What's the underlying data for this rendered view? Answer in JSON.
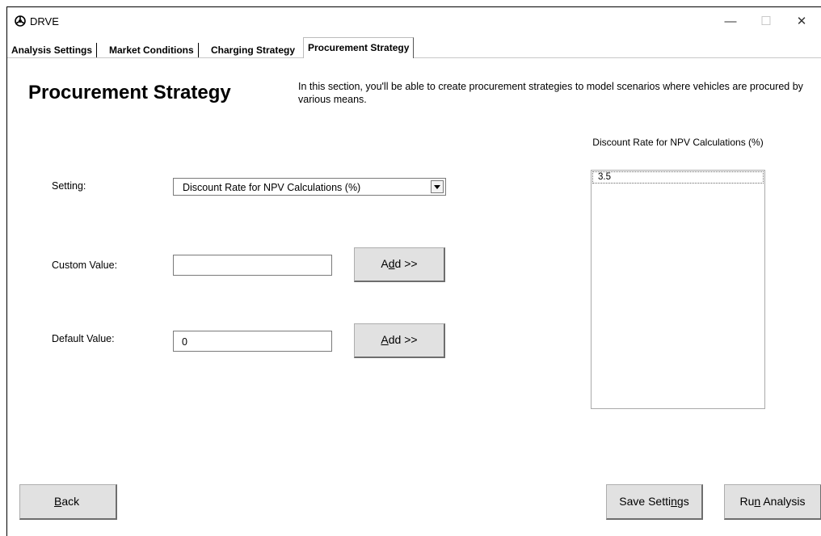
{
  "window": {
    "title": "DRVE",
    "icon": "drve-logo-icon",
    "controls": [
      "minimize",
      "maximize",
      "close"
    ]
  },
  "tabs": [
    {
      "label": "Analysis Settings"
    },
    {
      "label": "Market Conditions"
    },
    {
      "label": "Charging Strategy"
    },
    {
      "label": "Procurement Strategy",
      "active": true
    }
  ],
  "main": {
    "heading": "Procurement Strategy",
    "description": "In this section, you'll be able to create procurement strategies to model scenarios where vehicles are procured by various means."
  },
  "form": {
    "setting_label": "Setting:",
    "setting_value": "Discount Rate for NPV Calculations (%)",
    "custom_label": "Custom Value:",
    "custom_value": "",
    "custom_add_pre": "A",
    "custom_add_key": "d",
    "custom_add_post": "d >>",
    "default_label": "Default Value:",
    "default_value": "0",
    "default_add_key": "A",
    "default_add_post": "dd >>"
  },
  "list": {
    "header": "Discount Rate for NPV Calculations (%)",
    "items": [
      "3.5"
    ]
  },
  "footer": {
    "back_key": "B",
    "back_rest": "ack",
    "save_pre": "Save Setti",
    "save_key": "n",
    "save_post": "gs",
    "run_pre": "Ru",
    "run_key": "n",
    "run_post": " Analysis"
  },
  "colors": {
    "button_face": "#e1e1e1",
    "background": "#ffffff"
  }
}
